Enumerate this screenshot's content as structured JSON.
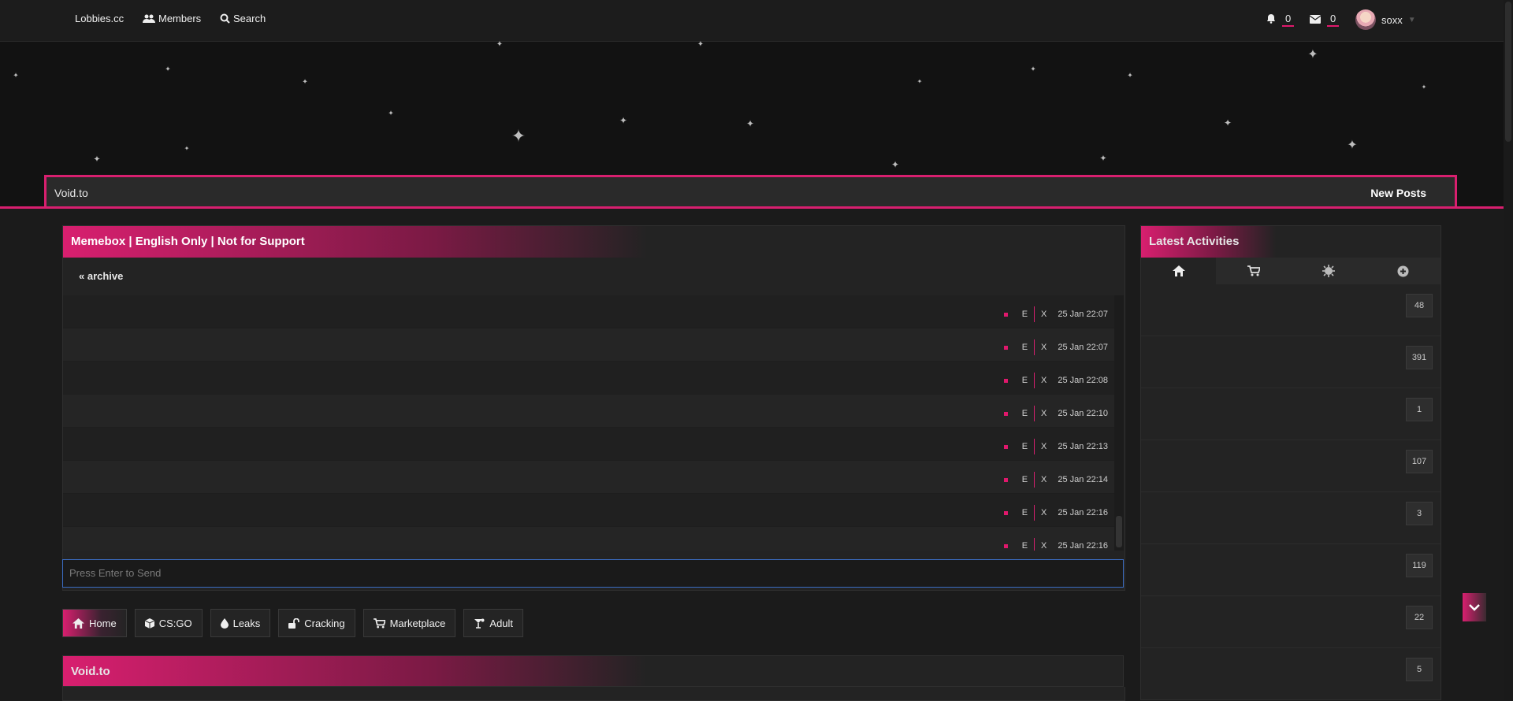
{
  "nav": {
    "brand": "Lobbies.cc",
    "members": "Members",
    "search": "Search",
    "notifications": "0",
    "messages": "0",
    "username": "soxx"
  },
  "breadcrumb": {
    "root": "Void.to",
    "new_posts": "New Posts"
  },
  "shoutbox": {
    "title": "Memebox | English Only | Not for Support",
    "archive": "« archive",
    "input_placeholder": "Press Enter to Send",
    "messages": [
      {
        "edit": "E",
        "delete": "X",
        "time": "25 Jan 22:07"
      },
      {
        "edit": "E",
        "delete": "X",
        "time": "25 Jan 22:07"
      },
      {
        "edit": "E",
        "delete": "X",
        "time": "25 Jan 22:08"
      },
      {
        "edit": "E",
        "delete": "X",
        "time": "25 Jan 22:10"
      },
      {
        "edit": "E",
        "delete": "X",
        "time": "25 Jan 22:13"
      },
      {
        "edit": "E",
        "delete": "X",
        "time": "25 Jan 22:14"
      },
      {
        "edit": "E",
        "delete": "X",
        "time": "25 Jan 22:16"
      },
      {
        "edit": "E",
        "delete": "X",
        "time": "25 Jan 22:16"
      }
    ]
  },
  "categories": [
    {
      "label": "Home",
      "icon": "home-icon",
      "active": true
    },
    {
      "label": "CS:GO",
      "icon": "cube-icon",
      "active": false
    },
    {
      "label": "Leaks",
      "icon": "drop-icon",
      "active": false
    },
    {
      "label": "Cracking",
      "icon": "unlock-icon",
      "active": false
    },
    {
      "label": "Marketplace",
      "icon": "cart-icon",
      "active": false
    },
    {
      "label": "Adult",
      "icon": "glass-icon",
      "active": false
    }
  ],
  "forum_section": {
    "title": "Void.to"
  },
  "sidebar": {
    "title": "Latest Activities",
    "tabs": [
      "home-icon",
      "cart-icon",
      "sun-icon",
      "plus-circle-icon"
    ],
    "activity_counts": [
      "48",
      "391",
      "1",
      "107",
      "3",
      "119",
      "22",
      "5"
    ]
  },
  "colors": {
    "accent": "#d81f6f",
    "background": "#1b1b1b",
    "panel": "#232323"
  }
}
